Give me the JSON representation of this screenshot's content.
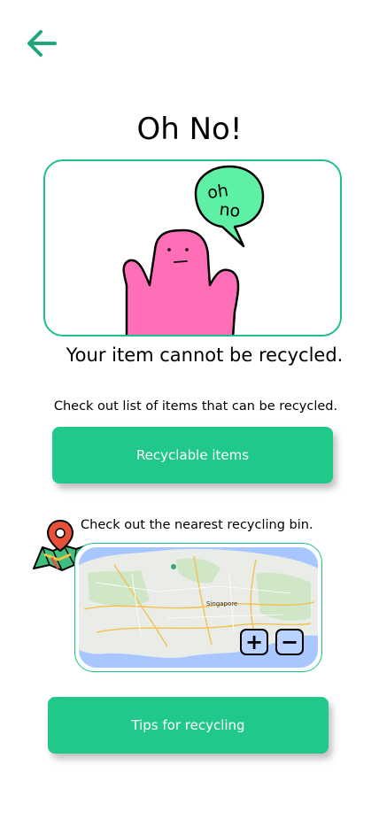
{
  "header": {
    "back_icon": "arrow-left-icon"
  },
  "page": {
    "title": "Oh No!"
  },
  "illustration": {
    "speech_bubble": "oh no",
    "bubble_line1": "oh",
    "bubble_line2": "no",
    "accent": "#1fc18a"
  },
  "result": {
    "message": "Your item cannot be recycled."
  },
  "recyclable_section": {
    "hint": "Check out list of items that can be recycled.",
    "button_label": "Recyclable items"
  },
  "map_section": {
    "hint": "Check out the nearest recycling bin.",
    "map_label": "Singapore",
    "zoom_in": "+",
    "zoom_out": "−",
    "icon": "folded-map-pin-icon"
  },
  "tips": {
    "button_label": "Tips for recycling"
  },
  "colors": {
    "primary": "#20c98a",
    "bubble": "#5ef0a4",
    "character": "#ff6fb8"
  }
}
